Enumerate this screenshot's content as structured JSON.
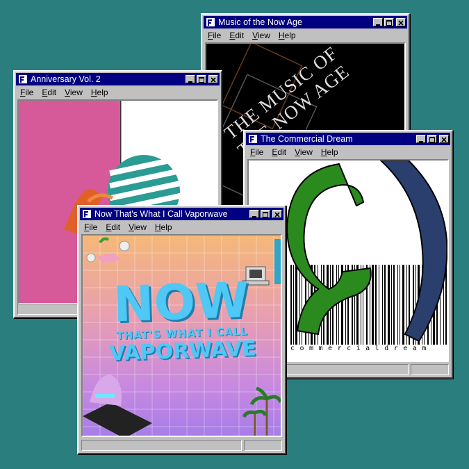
{
  "menu": {
    "file": "File",
    "edit": "Edit",
    "view": "View",
    "help": "Help"
  },
  "windows": {
    "music": {
      "title": "Music of the Now Age",
      "art_text_line1": "THE MUSIC OF",
      "art_text_line2": "THE NOW AGE"
    },
    "anniversary": {
      "title": "Anniversary Vol. 2"
    },
    "commercial": {
      "title": "The Commercial Dream",
      "art_text": "commercialdream"
    },
    "vaporwave": {
      "title": "Now That's What I Call Vaporwave",
      "art_big": "NOW",
      "art_sub1": "THAT'S WHAT I CALL",
      "art_sub2": "VAPORWAVE"
    }
  },
  "colors": {
    "desktop": "#2b7e7e",
    "titlebar": "#000080",
    "window": "#c0c0c0"
  }
}
